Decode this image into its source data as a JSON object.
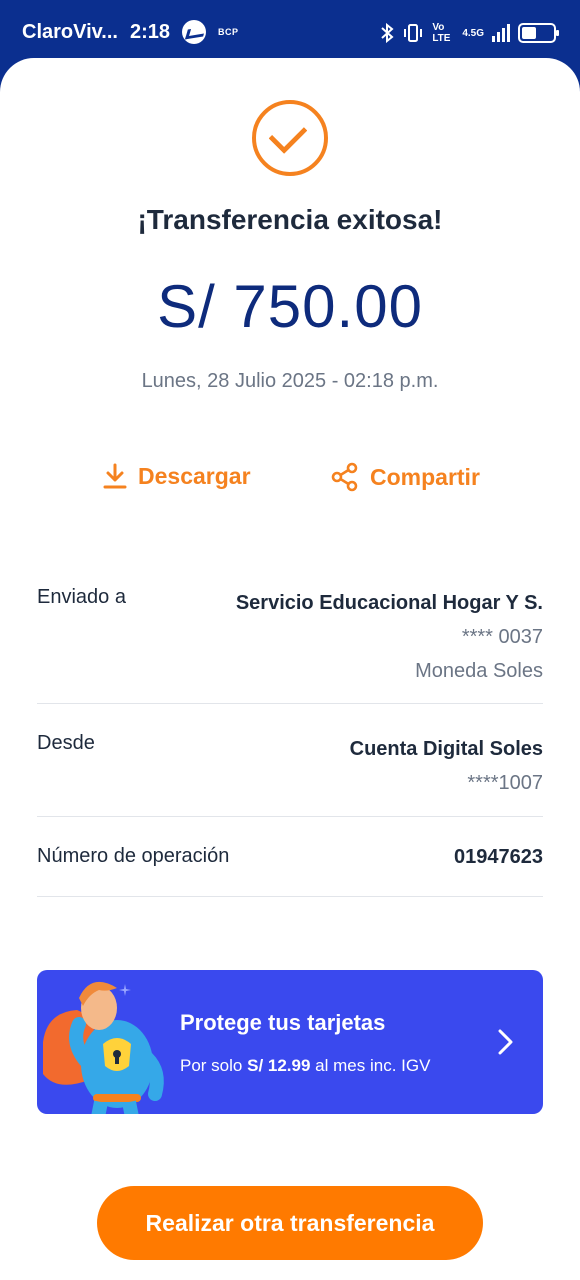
{
  "status_bar": {
    "carrier": "ClaroViv...",
    "time": "2:18",
    "bcp_label": "BCP",
    "network_label": "Vo LTE",
    "network_type": "4.5G"
  },
  "receipt": {
    "title": "¡Transferencia exitosa!",
    "amount": "S/ 750.00",
    "datetime": "Lunes, 28 Julio 2025 - 02:18 p.m.",
    "accent_color": "#f5821f",
    "amount_color": "#0e2b7c"
  },
  "actions": {
    "download_label": "Descargar",
    "share_label": "Compartir"
  },
  "details": {
    "sent_to": {
      "label": "Enviado a",
      "name": "Servicio Educacional Hogar Y S.",
      "account": "**** 0037",
      "currency": "Moneda Soles"
    },
    "from": {
      "label": "Desde",
      "account_name": "Cuenta Digital Soles",
      "account_number": "****1007"
    },
    "operation": {
      "label": "Número de operación",
      "value": "01947623"
    }
  },
  "banner": {
    "title": "Protege tus tarjetas",
    "sub_prefix": "Por solo",
    "sub_price": "S/ 12.99",
    "sub_suffix": "al mes inc. IGV",
    "background_color": "#3a49ee"
  },
  "cta": {
    "label": "Realizar otra transferencia",
    "color": "#ff7a00"
  }
}
